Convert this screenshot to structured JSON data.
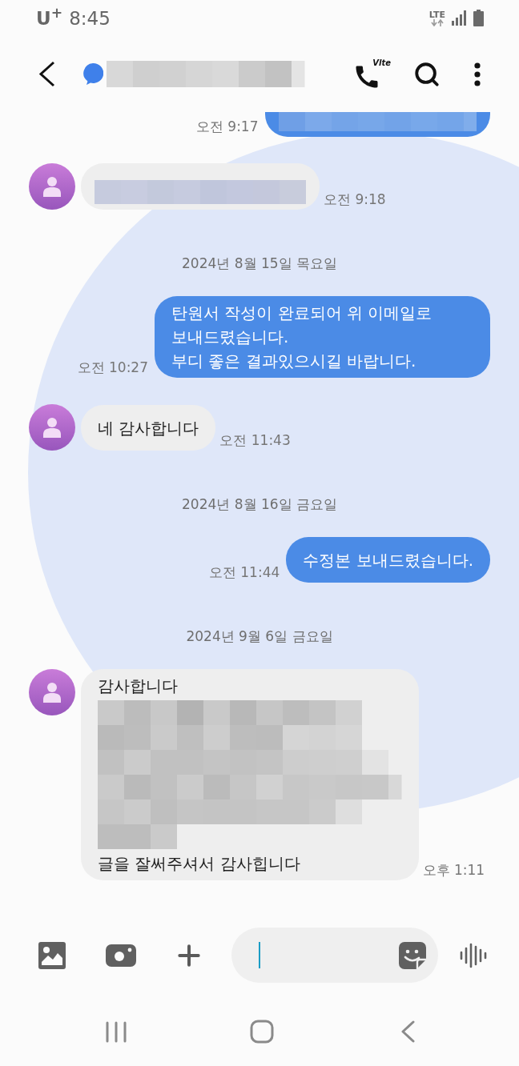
{
  "status_bar": {
    "carrier": "U$^{+}$",
    "time": "8:45",
    "network": "LTE"
  },
  "header": {
    "call_label": "Vlte"
  },
  "messages": [
    {
      "kind": "outgoing",
      "time": "오전 9:17",
      "parts": [
        {
          "kind": "redacted_line"
        }
      ]
    },
    {
      "kind": "incoming",
      "time": "오전 9:18",
      "parts": [
        {
          "kind": "redacted_line"
        }
      ]
    },
    {
      "kind": "date",
      "text": "2024년 8월 15일 목요일"
    },
    {
      "kind": "outgoing",
      "time": "오전 10:27",
      "parts": [
        {
          "kind": "text",
          "text": "탄원서 작성이 완료되어 위 이메일로 보내드렸습니다.\n부디 좋은 결과있으시길 바랍니다."
        }
      ]
    },
    {
      "kind": "incoming",
      "time": "오전 11:43",
      "parts": [
        {
          "kind": "text",
          "text": "네 감사합니다"
        }
      ]
    },
    {
      "kind": "date",
      "text": "2024년 8월 16일 금요일"
    },
    {
      "kind": "outgoing",
      "time": "오전 11:44",
      "parts": [
        {
          "kind": "text",
          "text": "수정본 보내드렸습니다."
        }
      ]
    },
    {
      "kind": "date",
      "text": "2024년 9월 6일 금요일"
    },
    {
      "kind": "incoming",
      "time": "오후 1:11",
      "parts": [
        {
          "kind": "text",
          "text": "감사합니다"
        },
        {
          "kind": "redacted_paragraph"
        },
        {
          "kind": "text",
          "text": "글을 잘써주셔서 감사힙니다"
        }
      ]
    }
  ],
  "composer": {
    "focused": true
  }
}
